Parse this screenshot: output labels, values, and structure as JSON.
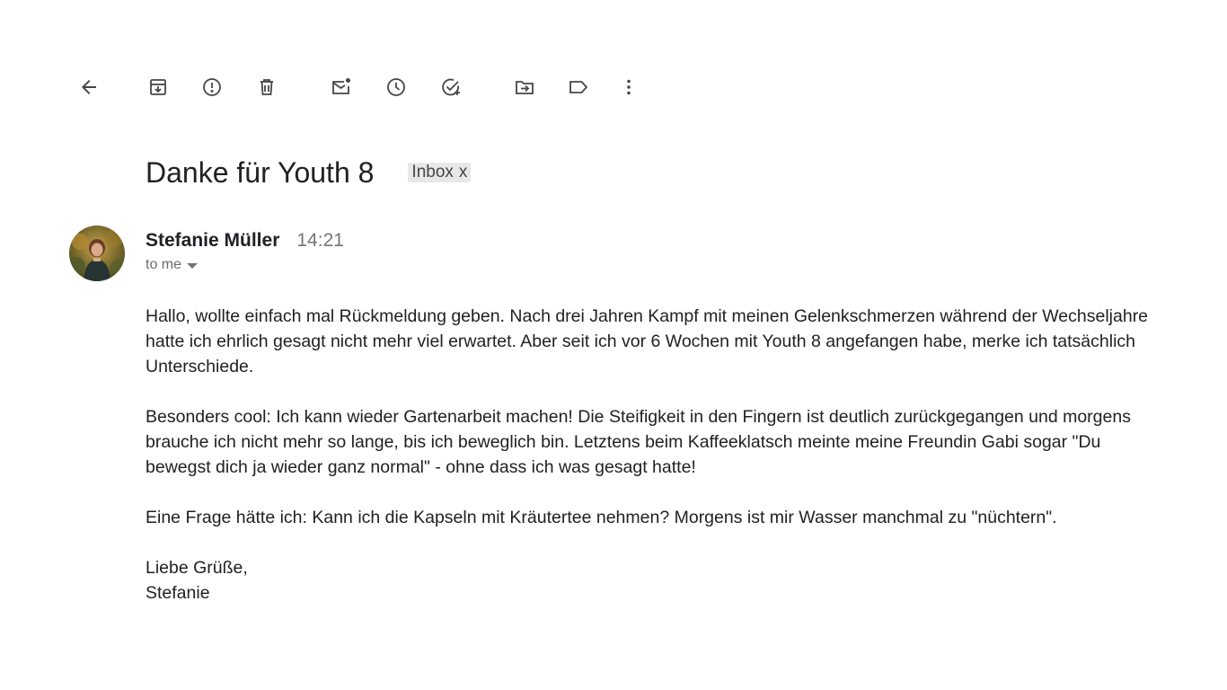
{
  "toolbar": {
    "buttons": [
      {
        "name": "back-button",
        "icon": "arrow-back-icon"
      },
      {
        "name": "archive-button",
        "icon": "archive-icon"
      },
      {
        "name": "report-spam-button",
        "icon": "report-spam-icon"
      },
      {
        "name": "delete-button",
        "icon": "trash-icon"
      },
      {
        "name": "mark-unread-button",
        "icon": "mark-unread-icon"
      },
      {
        "name": "snooze-button",
        "icon": "clock-icon"
      },
      {
        "name": "add-to-tasks-button",
        "icon": "add-task-icon"
      },
      {
        "name": "move-to-button",
        "icon": "move-to-folder-icon"
      },
      {
        "name": "labels-button",
        "icon": "label-icon"
      },
      {
        "name": "more-button",
        "icon": "more-vert-icon"
      }
    ]
  },
  "email": {
    "subject": "Danke für Youth 8",
    "label": "Inbox",
    "label_close": "x",
    "sender": {
      "name": "Stefanie Müller",
      "time": "14:21",
      "recipient": "to me"
    },
    "body": {
      "paragraphs": [
        "Hallo, wollte einfach mal Rückmeldung geben. Nach drei Jahren Kampf mit meinen Gelenkschmerzen während der Wechseljahre hatte ich ehrlich gesagt nicht mehr viel erwartet. Aber seit ich vor 6 Wochen mit Youth 8 angefangen habe, merke ich tatsächlich Unterschiede.",
        "Besonders cool: Ich kann wieder Gartenarbeit machen! Die Steifigkeit in den Fingern ist deutlich zurückgegangen und morgens brauche ich nicht mehr so lange, bis ich beweglich bin. Letztens beim Kaffeeklatsch meinte meine Freundin Gabi sogar \"Du bewegst dich ja wieder ganz normal\" - ohne dass ich was gesagt hatte!",
        "Eine Frage hätte ich: Kann ich die Kapseln mit Kräutertee nehmen? Morgens ist mir Wasser manchmal zu \"nüchtern\"."
      ],
      "closing": "Liebe Grüße,",
      "signature": "Stefanie"
    }
  },
  "colors": {
    "text": "#202124",
    "muted": "#757575",
    "icon": "#444746",
    "chip_bg": "#e8e8e8"
  }
}
